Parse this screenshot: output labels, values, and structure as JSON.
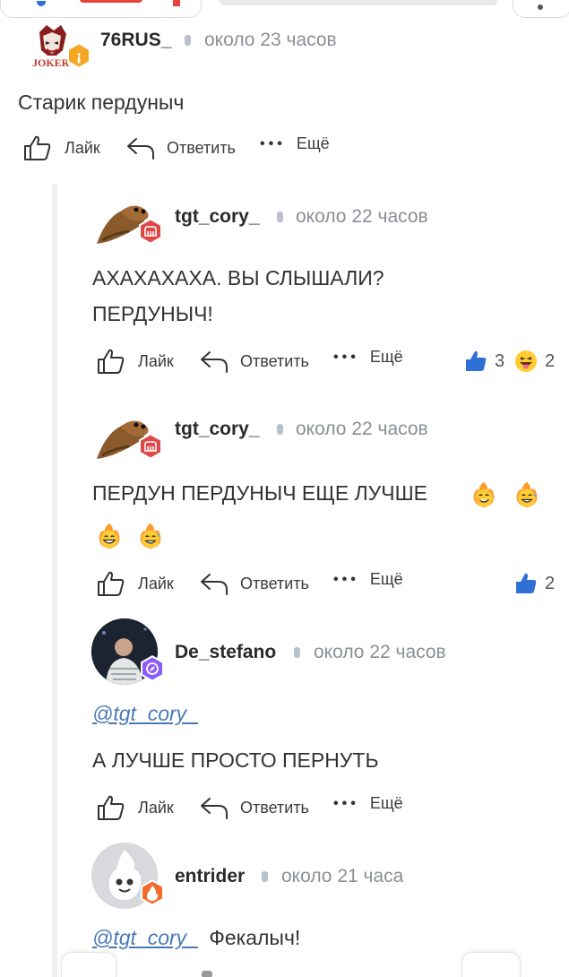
{
  "actions": {
    "like_label": "Лайк",
    "reply_label": "Ответить",
    "more_label": "Ещё"
  },
  "comments": [
    {
      "username": "76RUS_",
      "time": "около 23 часов",
      "text": "Старик пердуныч",
      "avatar_label": "JOKER"
    },
    {
      "username": "tgt_cory_",
      "time": "около 22 часов",
      "text_line1": "АХАХАХАХА. ВЫ СЛЫШАЛИ?",
      "text_line2": "ПЕРДУНЫЧ!",
      "reactions": {
        "thumbs_up": "3",
        "laugh": "2"
      }
    },
    {
      "username": "tgt_cory_",
      "time": "около 22 часов",
      "text": "ПЕРДУН ПЕРДУНЫЧ ЕЩЕ ЛУЧШЕ",
      "reactions": {
        "thumbs_up": "2"
      }
    },
    {
      "username": "De_stefano",
      "time": "около 22 часов",
      "mention": "@tgt_cory_",
      "text": "А ЛУЧШЕ ПРОСТО ПЕРНУТЬ"
    },
    {
      "username": "entrider",
      "time": "около 21 часа",
      "mention": "@tgt_cory_",
      "text": "Фекалыч!"
    }
  ],
  "colors": {
    "accent_blue": "#2f6fd6",
    "badge_red": "#e04848",
    "badge_orange": "#f5a623",
    "badge_purple": "#8b5cf6",
    "mention": "#4a78b8"
  }
}
